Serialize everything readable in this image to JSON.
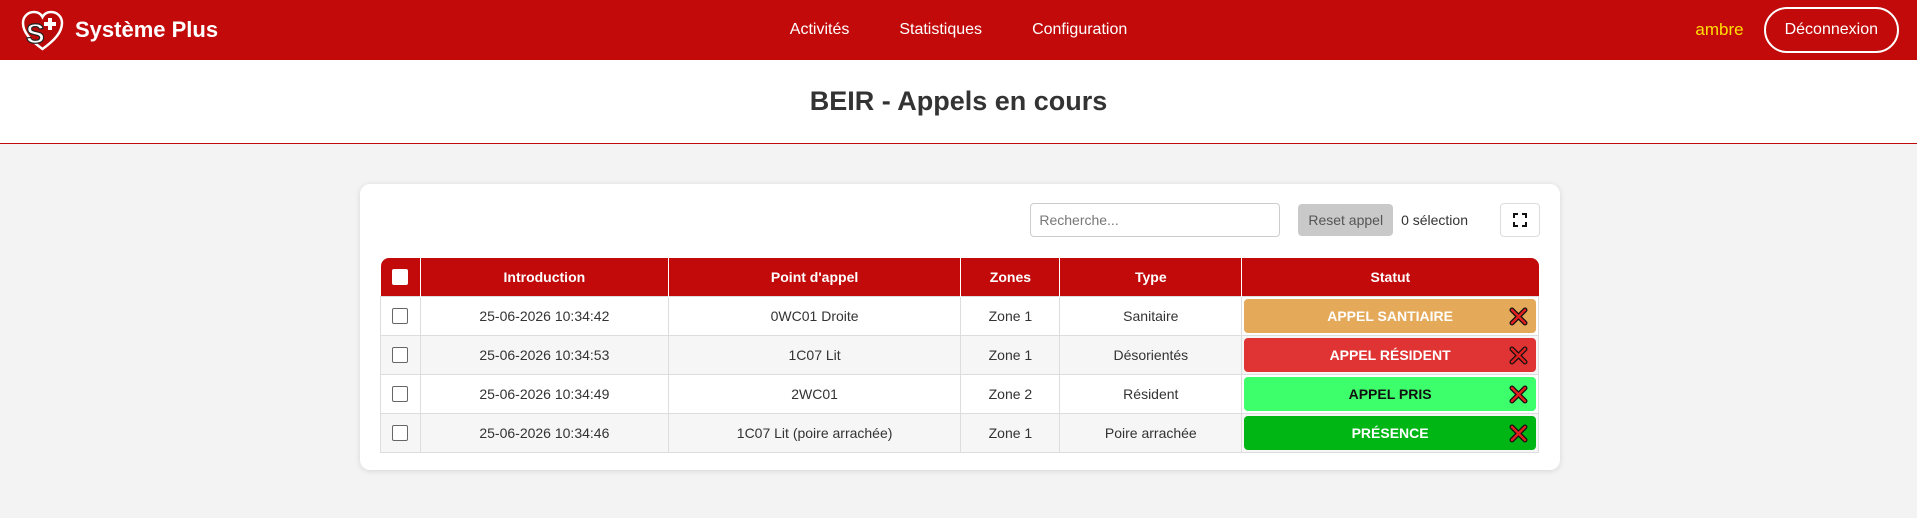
{
  "app": {
    "name": "Système Plus"
  },
  "nav": {
    "items": [
      {
        "label": "Activités"
      },
      {
        "label": "Statistiques"
      },
      {
        "label": "Configuration"
      }
    ],
    "user": "ambre",
    "logout_label": "Déconnexion"
  },
  "page": {
    "title": "BEIR - Appels en cours"
  },
  "toolbar": {
    "search_placeholder": "Recherche...",
    "reset_label": "Reset appel",
    "selection_text": "0 sélection"
  },
  "table": {
    "columns": [
      "Introduction",
      "Point d'appel",
      "Zones",
      "Type",
      "Statut"
    ],
    "rows": [
      {
        "introduction": "25-06-2026 10:34:42",
        "point": "0WC01 Droite",
        "zone": "Zone 1",
        "type": "Sanitaire",
        "status": "APPEL SANTIAIRE",
        "status_bg": "#e5a95a",
        "status_fg": "#ffffff"
      },
      {
        "introduction": "25-06-2026 10:34:53",
        "point": "1C07 Lit",
        "zone": "Zone 1",
        "type": "Désorientés",
        "status": "APPEL RÉSIDENT",
        "status_bg": "#e03434",
        "status_fg": "#ffffff"
      },
      {
        "introduction": "25-06-2026 10:34:49",
        "point": "2WC01",
        "zone": "Zone 2",
        "type": "Résident",
        "status": "APPEL PRIS",
        "status_bg": "#3dff6b",
        "status_fg": "#111111"
      },
      {
        "introduction": "25-06-2026 10:34:46",
        "point": "1C07 Lit (poire arrachée)",
        "zone": "Zone 1",
        "type": "Poire arrachée",
        "status": "PRÉSENCE",
        "status_bg": "#00b614",
        "status_fg": "#ffffff"
      }
    ]
  },
  "colors": {
    "primary": "#c20a0a",
    "user_name": "#ffe000"
  }
}
